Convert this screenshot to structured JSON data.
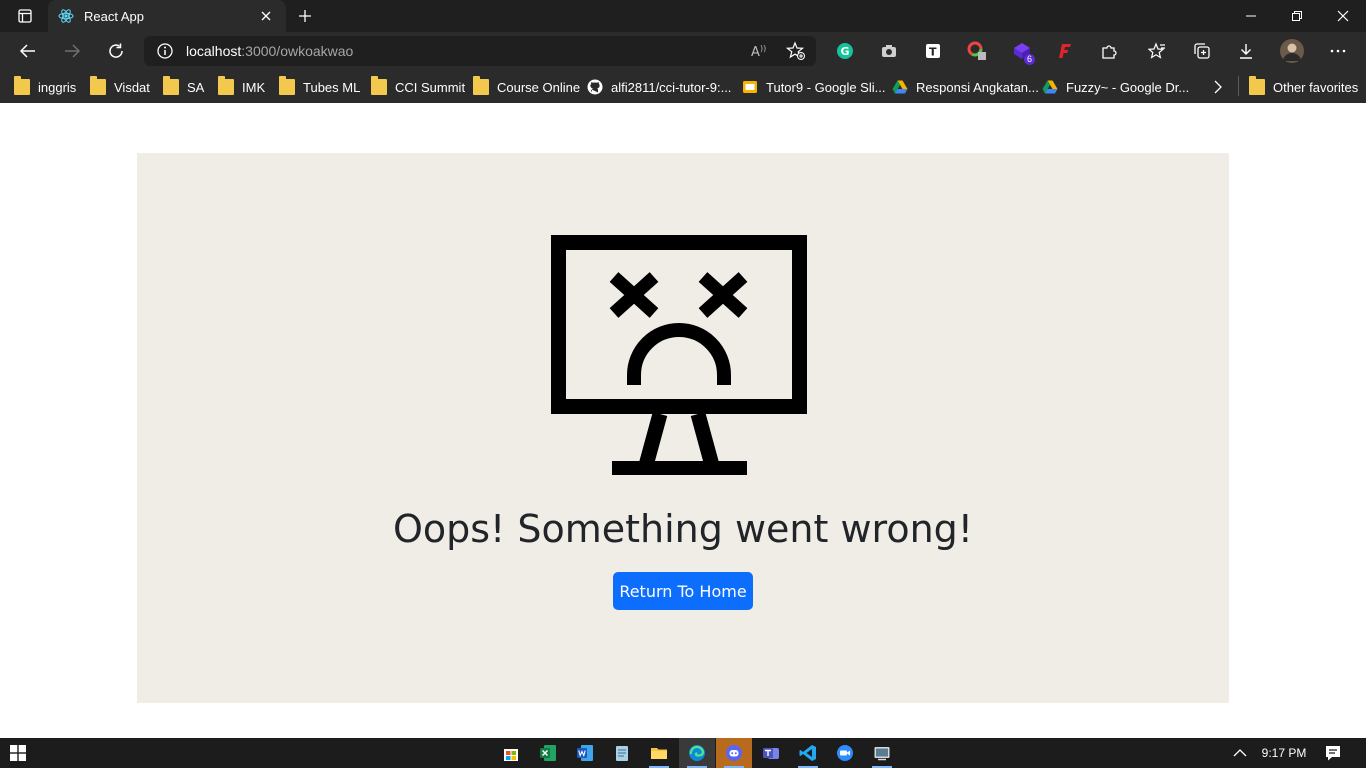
{
  "browser": {
    "tab": {
      "title": "React App"
    },
    "address": {
      "host": "localhost",
      "path": ":3000/owkoakwao"
    },
    "bookmarks": [
      {
        "label": "inggris",
        "icon": "folder-icon"
      },
      {
        "label": "Visdat",
        "icon": "folder-icon"
      },
      {
        "label": "SA",
        "icon": "folder-icon"
      },
      {
        "label": "IMK",
        "icon": "folder-icon"
      },
      {
        "label": "Tubes ML",
        "icon": "folder-icon"
      },
      {
        "label": "CCI Summit",
        "icon": "folder-icon"
      },
      {
        "label": "Course Online",
        "icon": "folder-icon"
      },
      {
        "label": "alfi2811/cci-tutor-9:...",
        "icon": "github-icon"
      },
      {
        "label": "Tutor9 - Google Sli...",
        "icon": "google-slides-icon"
      },
      {
        "label": "Responsi Angkatan...",
        "icon": "google-drive-icon"
      },
      {
        "label": "Fuzzy~ - Google Dr...",
        "icon": "google-drive-icon"
      }
    ],
    "other_favorites": "Other favorites",
    "extension_badge": "6"
  },
  "page": {
    "heading": "Oops! Something went wrong!",
    "button_label": "Return To Home"
  },
  "taskbar": {
    "time": "9:17 PM"
  },
  "colors": {
    "card_bg": "#f0ede6",
    "button_bg": "#0d6efd",
    "heading_color": "#212529"
  }
}
